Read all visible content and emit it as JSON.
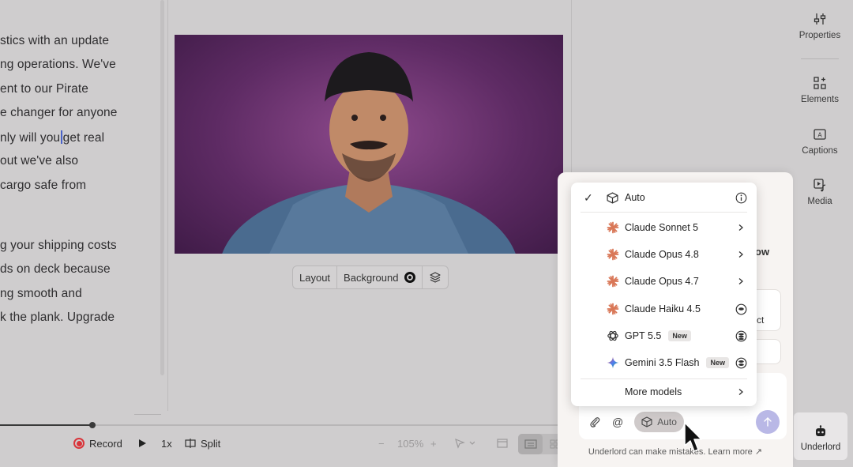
{
  "editor": {
    "lines": [
      "stics with an update",
      "ng operations. We've",
      "ent to our Pirate",
      "e changer for anyone",
      "nly will you",
      "get real",
      "out we've also",
      " cargo safe from",
      "g your shipping costs",
      "ds on deck because",
      "ng smooth and",
      "k the plank. Upgrade"
    ]
  },
  "canvas_toolbar": {
    "layout": "Layout",
    "background": "Background"
  },
  "bottom_bar": {
    "record": "Record",
    "speed": "1x",
    "split": "Split",
    "zoom": "105%"
  },
  "rail": {
    "properties": "Properties",
    "elements": "Elements",
    "captions": "Captions",
    "media": "Media",
    "underlord": "Underlord"
  },
  "chat": {
    "peek_title": "ow",
    "peek_text": "ct",
    "composer_model": "Auto",
    "disclaimer": "Underlord can make mistakes. Learn more ↗"
  },
  "model_menu": {
    "items": [
      {
        "label": "Auto",
        "selected": true,
        "icon": "cube-icon",
        "badge": "",
        "tail": "info-icon"
      },
      {
        "label": "Claude Sonnet 5",
        "selected": false,
        "icon": "claude-icon",
        "badge": "",
        "tail": "chevron-right-icon"
      },
      {
        "label": "Claude Opus 4.8",
        "selected": false,
        "icon": "claude-icon",
        "badge": "",
        "tail": "chevron-right-icon"
      },
      {
        "label": "Claude Opus 4.7",
        "selected": false,
        "icon": "claude-icon",
        "badge": "",
        "tail": "chevron-right-icon"
      },
      {
        "label": "Claude Haiku 4.5",
        "selected": false,
        "icon": "claude-icon",
        "badge": "",
        "tail": "coin-icon"
      },
      {
        "label": "GPT 5.5",
        "selected": false,
        "icon": "openai-icon",
        "badge": "New",
        "tail": "coins-stack-icon"
      },
      {
        "label": "Gemini 3.5 Flash",
        "selected": false,
        "icon": "gemini-icon",
        "badge": "New",
        "tail": "coins-stack-icon"
      },
      {
        "label": "More models",
        "selected": false,
        "icon": "",
        "badge": "",
        "tail": "chevron-right-icon"
      }
    ]
  },
  "colors": {
    "record": "#d9343a",
    "claude": "#d97757",
    "send": "#b9b8e6"
  }
}
